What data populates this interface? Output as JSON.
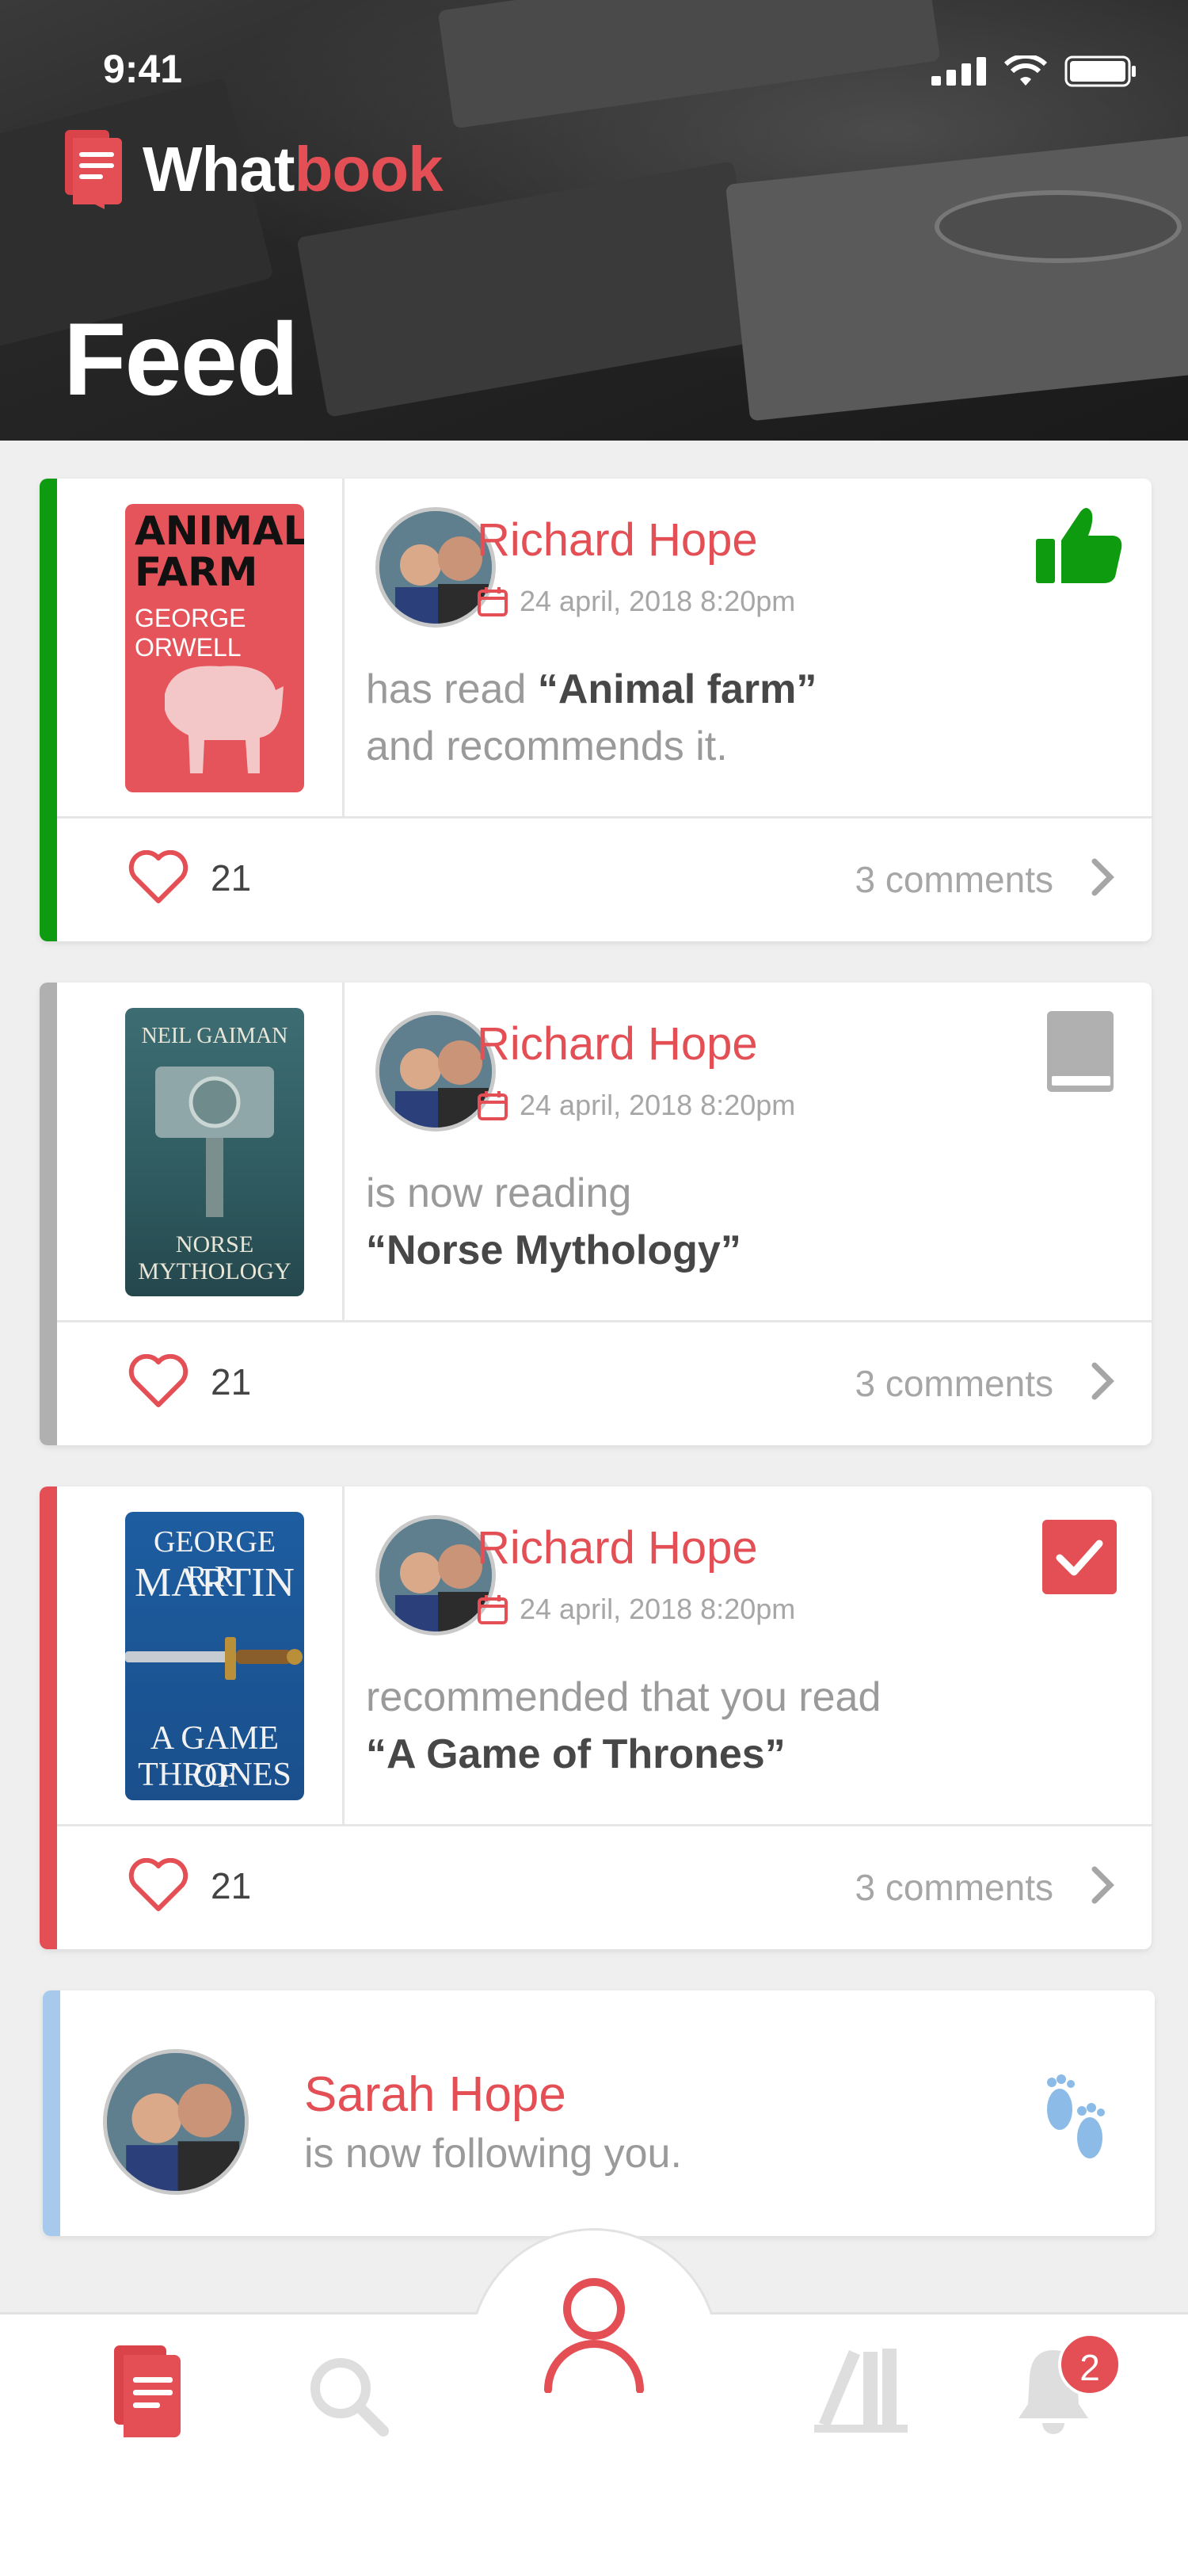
{
  "status_bar": {
    "time": "9:41"
  },
  "app": {
    "name_part1": "What",
    "name_part2": "book"
  },
  "page": {
    "title": "Feed"
  },
  "colors": {
    "brand": "#e34f55",
    "recommend": "#0f9b0f",
    "reading": "#b0b0b0",
    "suggest": "#e34f55",
    "follow": "#a7c9ec"
  },
  "feed": [
    {
      "user": "Richard Hope",
      "date": "24 april, 2018 8:20pm",
      "line1_prefix": "has read ",
      "book_title": "“Animal farm”",
      "line2": "and recommends it.",
      "likes": "21",
      "comments": "3 comments",
      "status_icon": "thumbs-up-icon",
      "cover": {
        "title_line1": "ANIMAL",
        "title_line2": "FARM",
        "author": "GEORGE ORWELL"
      }
    },
    {
      "user": "Richard Hope",
      "date": "24 april, 2018 8:20pm",
      "line1": "is now reading",
      "book_title": "“Norse Mythology”",
      "likes": "21",
      "comments": "3 comments",
      "status_icon": "book-icon",
      "cover": {
        "author": "NEIL GAIMAN",
        "title_line1": "NORSE",
        "title_line2": "MYTHOLOGY"
      }
    },
    {
      "user": "Richard Hope",
      "date": "24 april, 2018 8:20pm",
      "line1": "recommended that you read",
      "book_title": "“A Game of Thrones”",
      "likes": "21",
      "comments": "3 comments",
      "status_icon": "checkbox-icon",
      "cover": {
        "author_line1": "GEORGE R.R.",
        "author_line2": "MARTIN",
        "title_line1": "A GAME OF",
        "title_line2": "THRONES"
      }
    }
  ],
  "follow": {
    "user": "Sarah Hope",
    "text": "is now following you.",
    "icon": "footprints-icon"
  },
  "tabbar": {
    "tabs": [
      "feed-tab",
      "search-tab",
      "profile-tab",
      "library-tab",
      "notifications-tab"
    ],
    "notification_count": "2"
  }
}
